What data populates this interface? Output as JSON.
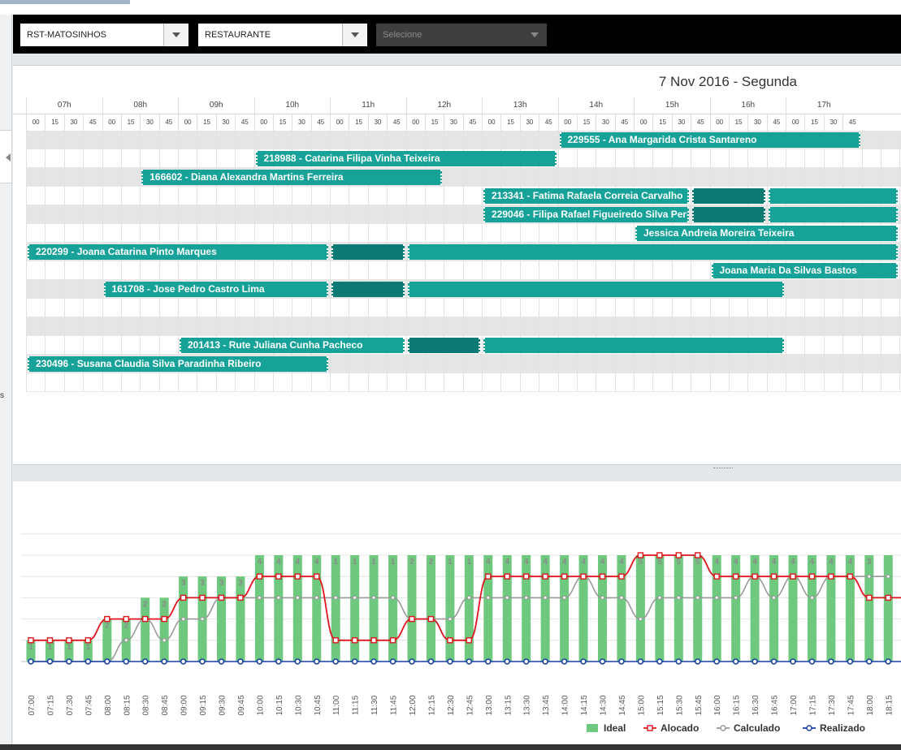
{
  "filters": {
    "store": "RST-MATOSINHOS",
    "section": "RESTAURANTE",
    "third": "Selecione"
  },
  "rail_text": "s",
  "date_title": "7 Nov 2016 - Segunda",
  "hours": [
    "07h",
    "08h",
    "09h",
    "10h",
    "11h",
    "12h",
    "13h",
    "14h",
    "15h",
    "16h",
    "17h"
  ],
  "quarters": [
    "00",
    "15",
    "30",
    "45"
  ],
  "rows": [
    {
      "bars": [
        {
          "start": "14:00",
          "end": "18:00",
          "label": "229555 - Ana Margarida Crista Santareno"
        }
      ]
    },
    {
      "bars": [
        {
          "start": "10:00",
          "end": "14:00",
          "label": "218988 - Catarina Filipa Vinha Teixeira"
        }
      ]
    },
    {
      "bars": [
        {
          "start": "08:30",
          "end": "12:30",
          "label": "166602 - Diana Alexandra Martins Ferreira"
        }
      ]
    },
    {
      "bars": [
        {
          "start": "13:00",
          "end": "15:45",
          "label": "213341 - Fatima Rafaela Correia Carvalho"
        },
        {
          "start": "15:45",
          "end": "16:45",
          "label": "",
          "dark": true
        },
        {
          "start": "16:45",
          "end": "18:30",
          "label": ""
        }
      ]
    },
    {
      "bars": [
        {
          "start": "13:00",
          "end": "15:45",
          "label": "229046 - Filipa Rafael Figueiredo Silva Pereira"
        },
        {
          "start": "15:45",
          "end": "16:45",
          "label": "",
          "dark": true
        },
        {
          "start": "16:45",
          "end": "18:30",
          "label": ""
        }
      ]
    },
    {
      "bars": [
        {
          "start": "15:00",
          "end": "18:30",
          "label": "Jessica Andreia Moreira Teixeira"
        }
      ]
    },
    {
      "bars": [
        {
          "start": "07:00",
          "end": "11:00",
          "label": "220299 - Joana Catarina Pinto Marques"
        },
        {
          "start": "11:00",
          "end": "12:00",
          "label": "",
          "dark": true
        },
        {
          "start": "12:00",
          "end": "18:30",
          "label": ""
        }
      ]
    },
    {
      "bars": [
        {
          "start": "16:00",
          "end": "18:30",
          "label": "Joana Maria Da Silvas Bastos"
        }
      ]
    },
    {
      "bars": [
        {
          "start": "08:00",
          "end": "11:00",
          "label": "161708 - Jose Pedro Castro Lima"
        },
        {
          "start": "11:00",
          "end": "12:00",
          "label": "",
          "dark": true
        },
        {
          "start": "12:00",
          "end": "17:00",
          "label": ""
        }
      ]
    },
    {
      "bars": []
    },
    {
      "bars": []
    },
    {
      "bars": [
        {
          "start": "09:00",
          "end": "12:00",
          "label": "201413 - Rute Juliana Cunha Pacheco"
        },
        {
          "start": "12:00",
          "end": "13:00",
          "label": "",
          "dark": true
        },
        {
          "start": "13:00",
          "end": "17:00",
          "label": ""
        }
      ]
    },
    {
      "bars": [
        {
          "start": "07:00",
          "end": "11:00",
          "label": "230496 - Susana Claudia Silva Paradinha Ribeiro"
        }
      ]
    },
    {
      "bars": []
    }
  ],
  "chart_data": {
    "type": "bar",
    "categories": [
      "07:00",
      "07:15",
      "07:30",
      "07:45",
      "08:00",
      "08:15",
      "08:30",
      "08:45",
      "09:00",
      "09:15",
      "09:30",
      "09:45",
      "10:00",
      "10:15",
      "10:30",
      "10:45",
      "11:00",
      "11:15",
      "11:30",
      "11:45",
      "12:00",
      "12:15",
      "12:30",
      "12:45",
      "13:00",
      "13:15",
      "13:30",
      "13:45",
      "14:00",
      "14:15",
      "14:30",
      "14:45",
      "15:00",
      "15:15",
      "15:30",
      "15:45",
      "16:00",
      "16:15",
      "16:30",
      "16:45",
      "17:00",
      "17:15",
      "17:30",
      "17:45",
      "18:00",
      "18:15"
    ],
    "series": [
      {
        "name": "Ideal",
        "type": "bar",
        "color": "#6ec87e",
        "values": [
          1,
          1,
          1,
          1,
          2,
          2,
          3,
          3,
          4,
          4,
          4,
          4,
          5,
          5,
          5,
          5,
          5,
          5,
          5,
          5,
          5,
          5,
          5,
          5,
          5,
          5,
          5,
          5,
          5,
          5,
          5,
          5,
          5,
          5,
          5,
          5,
          5,
          5,
          5,
          5,
          5,
          5,
          5,
          5,
          5,
          5
        ]
      },
      {
        "name": "Alocado",
        "type": "line",
        "color": "#e0141c",
        "values": [
          1,
          1,
          1,
          1,
          2,
          2,
          2,
          2,
          3,
          3,
          3,
          3,
          4,
          4,
          4,
          4,
          1,
          1,
          1,
          1,
          2,
          2,
          1,
          1,
          4,
          4,
          4,
          4,
          4,
          4,
          4,
          4,
          5,
          5,
          5,
          5,
          4,
          4,
          4,
          4,
          4,
          4,
          4,
          4,
          3,
          3
        ],
        "labels": [
          "1",
          "1",
          "1",
          "1",
          "2",
          "2",
          "2",
          "2",
          "3",
          "3",
          "3",
          "3",
          "4",
          "4",
          "4",
          "4",
          "1",
          "1",
          "1",
          "1",
          "2",
          "2",
          "1",
          "1",
          "4",
          "4",
          "4",
          "4",
          "4",
          "4",
          "4",
          "4",
          "5",
          "5",
          "5",
          "5",
          "4",
          "4",
          "4",
          "4",
          "4",
          "4",
          "4",
          "4",
          "3",
          ""
        ]
      },
      {
        "name": "Calculado",
        "type": "line",
        "color": "#999999",
        "values": [
          0,
          0,
          0,
          0,
          0,
          1,
          2,
          1,
          2,
          2,
          3,
          3,
          3,
          3,
          3,
          3,
          3,
          3,
          3,
          3,
          2,
          2,
          2,
          3,
          3,
          3,
          3,
          3,
          3,
          4,
          3,
          3,
          2,
          3,
          3,
          3,
          3,
          3,
          4,
          3,
          4,
          3,
          4,
          4,
          4,
          4
        ]
      },
      {
        "name": "Realizado",
        "type": "line",
        "color": "#1a3fa8",
        "values": [
          0,
          0,
          0,
          0,
          0,
          0,
          0,
          0,
          0,
          0,
          0,
          0,
          0,
          0,
          0,
          0,
          0,
          0,
          0,
          0,
          0,
          0,
          0,
          0,
          0,
          0,
          0,
          0,
          0,
          0,
          0,
          0,
          0,
          0,
          0,
          0,
          0,
          0,
          0,
          0,
          0,
          0,
          0,
          0,
          0,
          0
        ]
      }
    ],
    "ylim": [
      0,
      6
    ],
    "grid": true,
    "legend": "bottom-right"
  }
}
